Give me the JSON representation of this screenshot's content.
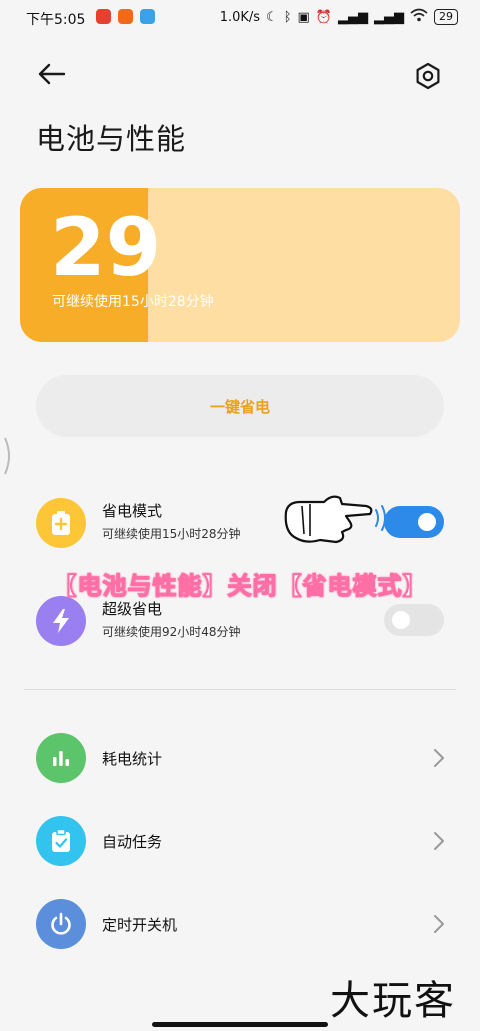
{
  "status_bar": {
    "time": "下午5:05",
    "speed": "1.0K/s",
    "battery": "29"
  },
  "header": {
    "title": "电池与性能"
  },
  "battery_card": {
    "level": 29,
    "percent_text": "29",
    "percent_sign": "%",
    "remaining": "可继续使用15小时28分钟"
  },
  "one_key_save": {
    "label": "一键省电"
  },
  "modes": [
    {
      "title": "省电模式",
      "subtitle": "可继续使用15小时28分钟",
      "enabled": true
    },
    {
      "title": "超级省电",
      "subtitle": "可继续使用92小时48分钟",
      "enabled": false
    }
  ],
  "overlay": {
    "caption": "【电池与性能】关闭【省电模式】"
  },
  "menu": [
    {
      "label": "耗电统计",
      "icon": "bar-chart-icon"
    },
    {
      "label": "自动任务",
      "icon": "clipboard-check-icon"
    },
    {
      "label": "定时开关机",
      "icon": "power-icon"
    }
  ],
  "watermark": "大玩客",
  "colors": {
    "battery_fill": "#f7ad27",
    "battery_bg": "#ffdea3",
    "toggle_on": "#2d8ae8",
    "toggle_off": "#e4e4e4",
    "accent_text": "#e9a21c"
  }
}
